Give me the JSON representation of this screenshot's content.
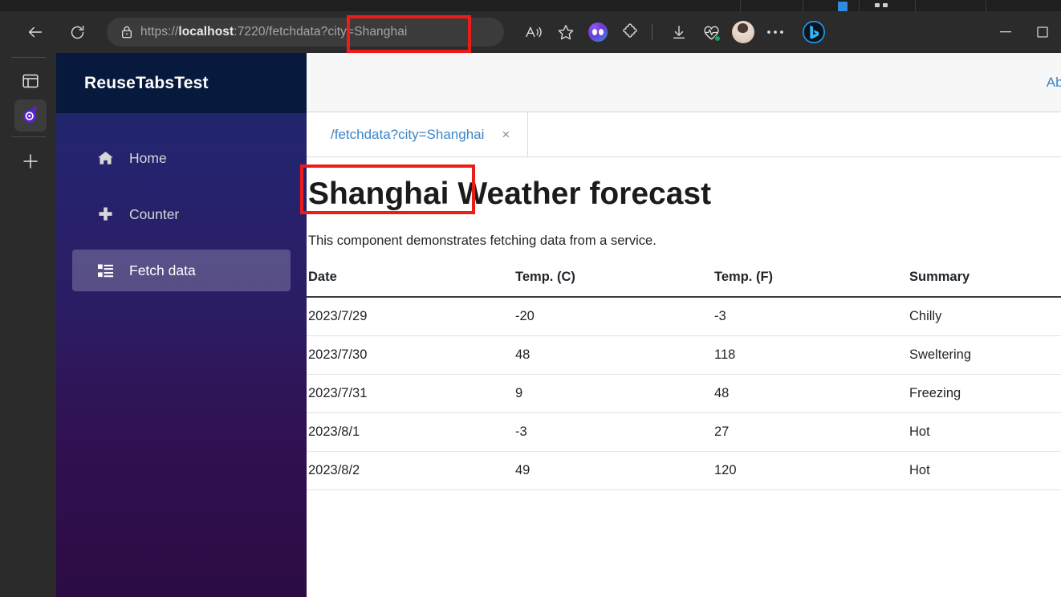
{
  "browser": {
    "back_label": "Back",
    "reload_label": "Refresh",
    "url": {
      "scheme": "https://",
      "host": "localhost",
      "rest": ":7220/fetchdata?city=Shanghai",
      "full": "https://localhost:7220/fetchdata?city=Shanghai"
    },
    "toolbar_icons": [
      "read-aloud-icon",
      "favorite-star-icon",
      "copilot-orb-icon",
      "extensions-puzzle-icon",
      "downloads-icon",
      "browser-essentials-icon",
      "profile-avatar-icon",
      "settings-ellipsis-icon",
      "bing-chat-icon"
    ],
    "window_controls": {
      "minimize": "─",
      "maximize": "☐"
    },
    "rail": {
      "tab_list_label": "Tab actions",
      "active_tab_label": "ReuseTabsTest",
      "new_tab_label": "+"
    }
  },
  "app": {
    "brand": "ReuseTabsTest",
    "about_link": "Abo",
    "nav": [
      {
        "label": "Home",
        "icon": "home-icon",
        "active": false
      },
      {
        "label": "Counter",
        "icon": "plus-icon",
        "active": false
      },
      {
        "label": "Fetch data",
        "icon": "list-icon",
        "active": true
      }
    ],
    "reuse_tabs": [
      {
        "label": "/fetchdata?city=Shanghai",
        "close": "×",
        "active": true
      }
    ],
    "page": {
      "city": "Shanghai",
      "title_suffix": " Weather forecast",
      "description": "This component demonstrates fetching data from a service."
    }
  },
  "forecast_table": {
    "columns": [
      "Date",
      "Temp. (C)",
      "Temp. (F)",
      "Summary"
    ],
    "rows": [
      {
        "date": "2023/7/29",
        "c": "-20",
        "f": "-3",
        "summary": "Chilly"
      },
      {
        "date": "2023/7/30",
        "c": "48",
        "f": "118",
        "summary": "Sweltering"
      },
      {
        "date": "2023/7/31",
        "c": "9",
        "f": "48",
        "summary": "Freezing"
      },
      {
        "date": "2023/8/1",
        "c": "-3",
        "f": "27",
        "summary": "Hot"
      },
      {
        "date": "2023/8/2",
        "c": "49",
        "f": "120",
        "summary": "Hot"
      }
    ]
  },
  "annotations": [
    {
      "name": "url-query-highlight",
      "target": "?city=Shanghai",
      "color": "#ef1b1b"
    },
    {
      "name": "title-city-highlight",
      "target": "Shanghai",
      "color": "#ef1b1b"
    }
  ],
  "colors": {
    "annotation_red": "#ef1b1b",
    "link_blue": "#3b86c8",
    "brand_navy": "#071a3d",
    "chrome_dark": "#2b2b2b"
  }
}
